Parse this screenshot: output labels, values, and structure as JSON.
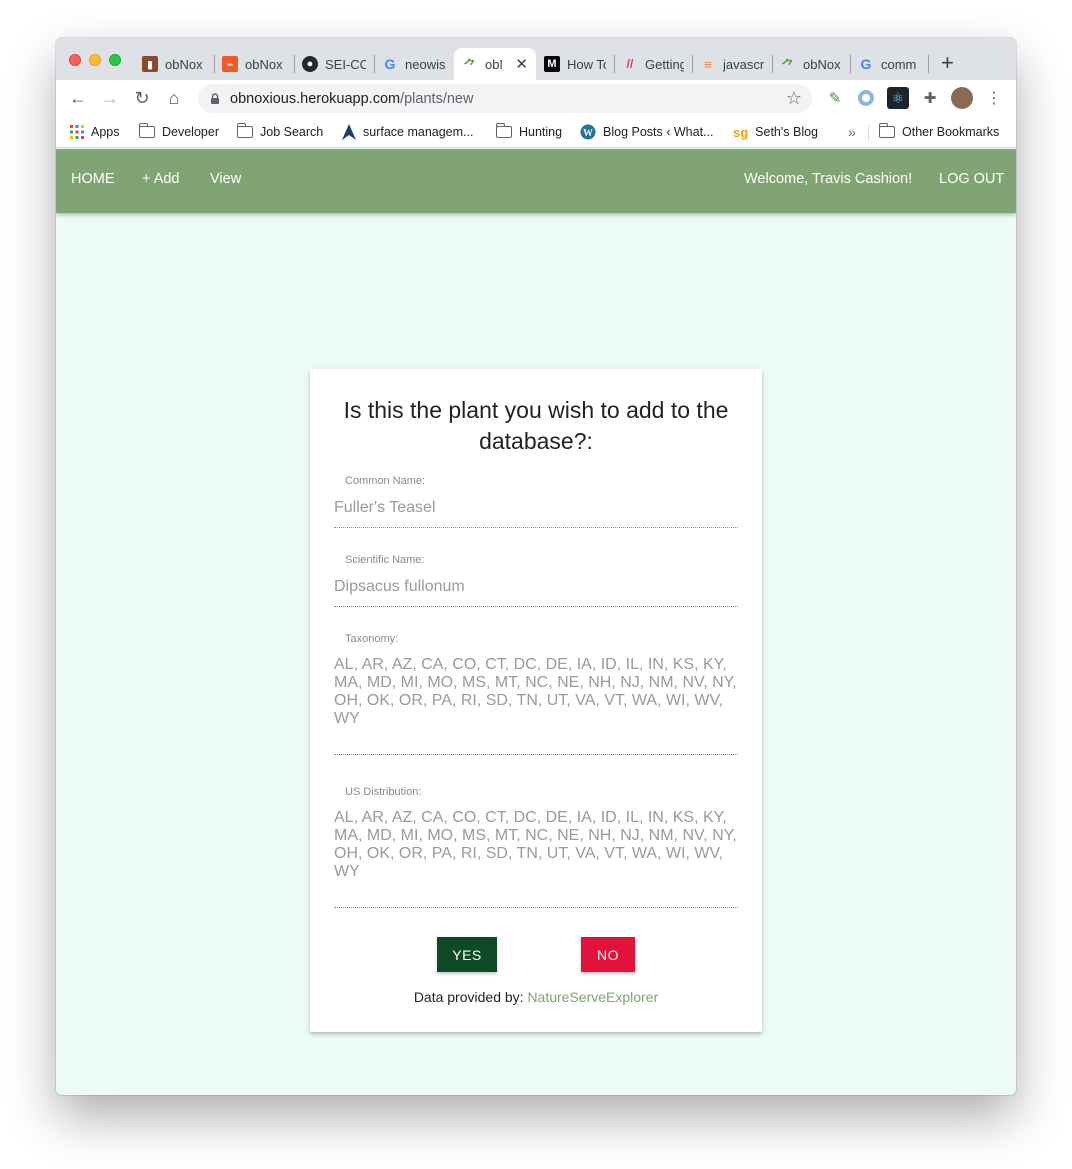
{
  "browser": {
    "tabs": [
      {
        "title": "obNox",
        "icon": "trello-icon"
      },
      {
        "title": "obNox",
        "icon": "postman-icon"
      },
      {
        "title": "SEI-CC",
        "icon": "github-icon"
      },
      {
        "title": "neowis",
        "icon": "google-icon"
      },
      {
        "title": "obN",
        "icon": "plant-icon",
        "active": true
      },
      {
        "title": "How To",
        "icon": "medium-icon"
      },
      {
        "title": "Getting",
        "icon": "dev-icon"
      },
      {
        "title": "javascr",
        "icon": "stackoverflow-icon"
      },
      {
        "title": "obNox",
        "icon": "plant-icon"
      },
      {
        "title": "comm",
        "icon": "google-icon"
      }
    ],
    "url_host": "obnoxious.herokuapp.com",
    "url_path": "/plants/new",
    "bookmarks": [
      {
        "label": "Apps",
        "icon": "apps-grid-icon"
      },
      {
        "label": "Developer",
        "icon": "folder-icon"
      },
      {
        "label": "Job Search",
        "icon": "folder-icon"
      },
      {
        "label": "surface managem...",
        "icon": "arrow-logo-icon"
      },
      {
        "label": "Hunting",
        "icon": "folder-icon"
      },
      {
        "label": "Blog Posts ‹ What...",
        "icon": "wordpress-icon"
      },
      {
        "label": "Seth's Blog",
        "icon": "sg-icon"
      },
      {
        "label": "»",
        "icon": "overflow"
      },
      {
        "label": "Other Bookmarks",
        "icon": "folder-icon"
      }
    ]
  },
  "nav": {
    "home": "HOME",
    "add": "+ Add",
    "view": "View",
    "welcome": "Welcome, Travis Cashion!",
    "logout": "LOG OUT",
    "color": "#81a474"
  },
  "card": {
    "title": "Is this the plant you wish to add to the database?:",
    "common_name_label": "Common Name:",
    "common_name": "Fuller's Teasel",
    "scientific_name_label": "Scientific Name:",
    "scientific_name": "Dipsacus fullonum",
    "taxonomy_label": "Taxonomy:",
    "taxonomy": "AL, AR, AZ, CA, CO, CT, DC, DE, IA, ID, IL, IN, KS, KY, MA, MD, MI, MO, MS, MT, NC, NE, NH, NJ, NM, NV, NY, OH, OK, OR, PA, RI, SD, TN, UT, VA, VT, WA, WI, WV, WY",
    "distribution_label": "US Distribution:",
    "distribution": "AL, AR, AZ, CA, CO, CT, DC, DE, IA, ID, IL, IN, KS, KY, MA, MD, MI, MO, MS, MT, NC, NE, NH, NJ, NM, NV, NY, OH, OK, OR, PA, RI, SD, TN, UT, VA, VT, WA, WI, WV, WY",
    "yes_label": "YES",
    "no_label": "NO",
    "credit_prefix": "Data provided by: ",
    "credit_link": "NatureServeExplorer",
    "yes_color": "#0d4a25",
    "no_color": "#e3123c"
  }
}
